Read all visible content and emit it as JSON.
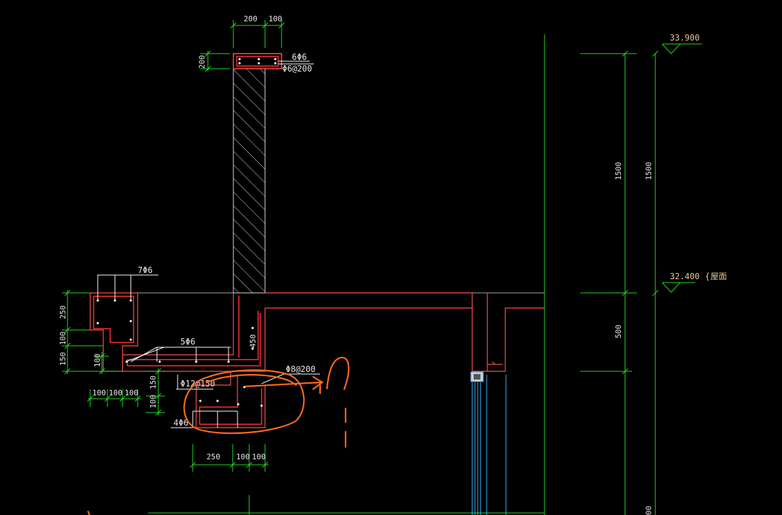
{
  "drawing": {
    "top_dims": [
      "200",
      "100"
    ],
    "cap_height": "200",
    "cap_rebar_main": "6Φ6",
    "cap_rebar_stirrup": "Φ6@200",
    "elevation_top": "33.900",
    "elevation_roof": "32.400",
    "roof_label": "屋面",
    "dim_1500_a": "1500",
    "dim_1500_b": "1500",
    "dim_500": "500",
    "dim_450": "450",
    "left_rebar_7": "7Φ6",
    "left_rebar_5": "5Φ6",
    "left_dims_v": [
      "250",
      "100",
      "150",
      "100"
    ],
    "gutter_rebar_12": "Φ12@150",
    "gutter_rebar_8": "Φ8@200",
    "gutter_rebar_4": "4Φ6",
    "gutter_dims_v": [
      "150",
      "100"
    ],
    "left_bottom_dims": [
      "100",
      "100",
      "100"
    ],
    "bottom_dims": [
      "250",
      "100",
      "100"
    ],
    "bottom_right_dim": "00"
  },
  "colors": {
    "background": "#000000",
    "dimension_line": "#22dd22",
    "outline": "#ff5050",
    "hatch": "#dddddd",
    "markup": "#ff6a1a",
    "glass": "#39b6ff"
  }
}
